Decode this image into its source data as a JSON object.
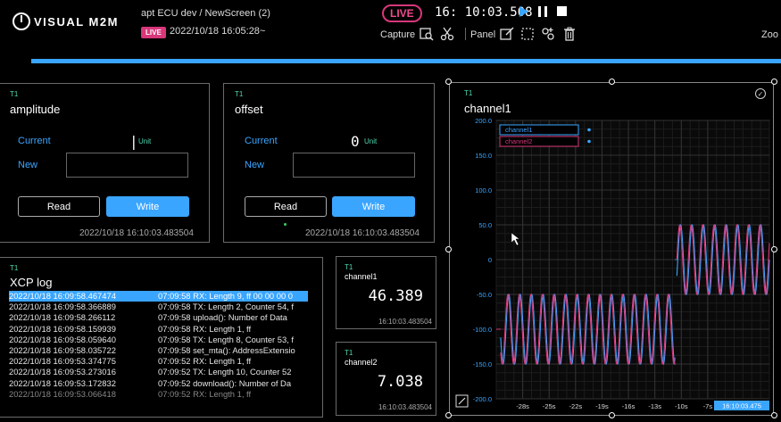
{
  "header": {
    "logo_text": "VISUAL M2M",
    "project_title": "apt ECU dev / NewScreen (2)",
    "live_small": "LIVE",
    "timestamp": "2022/10/18 16:05:28~",
    "live_big": "LIVE",
    "clock": "16: 10:03.508",
    "capture_label": "Capture",
    "panel_label": "Panel",
    "zoom_label": "Zoo",
    "progress": 1.0,
    "accent_color": "#3aa5ff",
    "live_color": "#d8377a"
  },
  "amplitude_panel": {
    "tag": "T1",
    "title": "amplitude",
    "current_label": "Current",
    "current_value": "|",
    "unit": "Unit",
    "new_label": "New",
    "new_value": "",
    "read_label": "Read",
    "write_label": "Write",
    "timestamp": "2022/10/18 16:10:03.483504"
  },
  "offset_panel": {
    "tag": "T1",
    "title": "offset",
    "current_label": "Current",
    "current_value": "0",
    "unit": "Unit",
    "new_label": "New",
    "new_value": "",
    "read_label": "Read",
    "write_label": "Write",
    "timestamp": "2022/10/18 16:10:03.483504"
  },
  "xcp_log": {
    "tag": "T1",
    "title": "XCP log",
    "rows": [
      {
        "t": "2022/10/18 16:09:58.467474",
        "m": "07:09:58 RX: Length 9, ff 00 00 00 0"
      },
      {
        "t": "2022/10/18 16:09:58.366889",
        "m": "07:09:58 TX: Length 2, Counter 54, f"
      },
      {
        "t": "2022/10/18 16:09:58.266112",
        "m": "07:09:58 upload(): Number of Data"
      },
      {
        "t": "2022/10/18 16:09:58.159939",
        "m": "07:09:58 RX: Length 1, ff"
      },
      {
        "t": "2022/10/18 16:09:58.059640",
        "m": "07:09:58 TX: Length 8, Counter 53, f"
      },
      {
        "t": "2022/10/18 16:09:58.035722",
        "m": "07:09:58 set_mta(): AddressExtensio"
      },
      {
        "t": "2022/10/18 16:09:53.374775",
        "m": "07:09:52 RX: Length 1, ff"
      },
      {
        "t": "2022/10/18 16:09:53.273016",
        "m": "07:09:52 TX: Length 10, Counter 52"
      },
      {
        "t": "2022/10/18 16:09:53.172832",
        "m": "07:09:52 download(): Number of Da"
      },
      {
        "t": "2022/10/18 16:09:53.066418",
        "m": "07:09:52 RX: Length 1, ff"
      }
    ]
  },
  "value_channel1": {
    "tag": "T1",
    "title": "channel1",
    "value": "46.389",
    "timestamp": "16:10:03.483504"
  },
  "value_channel2": {
    "tag": "T1",
    "title": "channel2",
    "value": "7.038",
    "timestamp": "16:10:03.483504"
  },
  "chart_panel": {
    "tag": "T1",
    "title": "channel1",
    "cursor_time": "16:10:03.475"
  },
  "chart_data": {
    "type": "line",
    "title": "channel1",
    "ylim": [
      -200,
      200
    ],
    "yticks": [
      "200.0",
      "150.0",
      "100.0",
      "50.0",
      "0",
      "-50.0",
      "-100.0",
      "-150.0",
      "-200.0"
    ],
    "xlim": [
      -31,
      0
    ],
    "xticks": [
      "-28s",
      "-25s",
      "-22s",
      "-19s",
      "-16s",
      "-13s",
      "-10s",
      "-7s"
    ],
    "xtick_values": [
      -28,
      -25,
      -22,
      -19,
      -16,
      -13,
      -10,
      -7
    ],
    "grid": true,
    "legend": "top-left",
    "series": [
      {
        "name": "channel1",
        "color": "#3aa5ff",
        "segments": [
          {
            "x0": -31,
            "x1": -30.5,
            "center": -100,
            "amp": 0,
            "period": 1.3,
            "phase": 0
          },
          {
            "x0": -30.5,
            "x1": -10.7,
            "center": -100,
            "amp": 50,
            "period": 1.3,
            "phase": 0
          },
          {
            "x0": -10.7,
            "x1": -10.5,
            "center": 0,
            "amp": 0,
            "period": 1.3,
            "phase": 0
          },
          {
            "x0": -10.5,
            "x1": 0,
            "center": 0,
            "amp": 50,
            "period": 1.3,
            "phase": 0
          }
        ]
      },
      {
        "name": "channel2",
        "color": "#d8377a",
        "segments": [
          {
            "x0": -31,
            "x1": -30.5,
            "center": -100,
            "amp": 0,
            "period": 1.3,
            "phase": 0.5
          },
          {
            "x0": -30.5,
            "x1": -10.7,
            "center": -100,
            "amp": 50,
            "period": 1.3,
            "phase": 0.5
          },
          {
            "x0": -10.5,
            "x1": 0,
            "center": 0,
            "amp": 50,
            "period": 1.3,
            "phase": 0.5
          }
        ]
      }
    ]
  }
}
